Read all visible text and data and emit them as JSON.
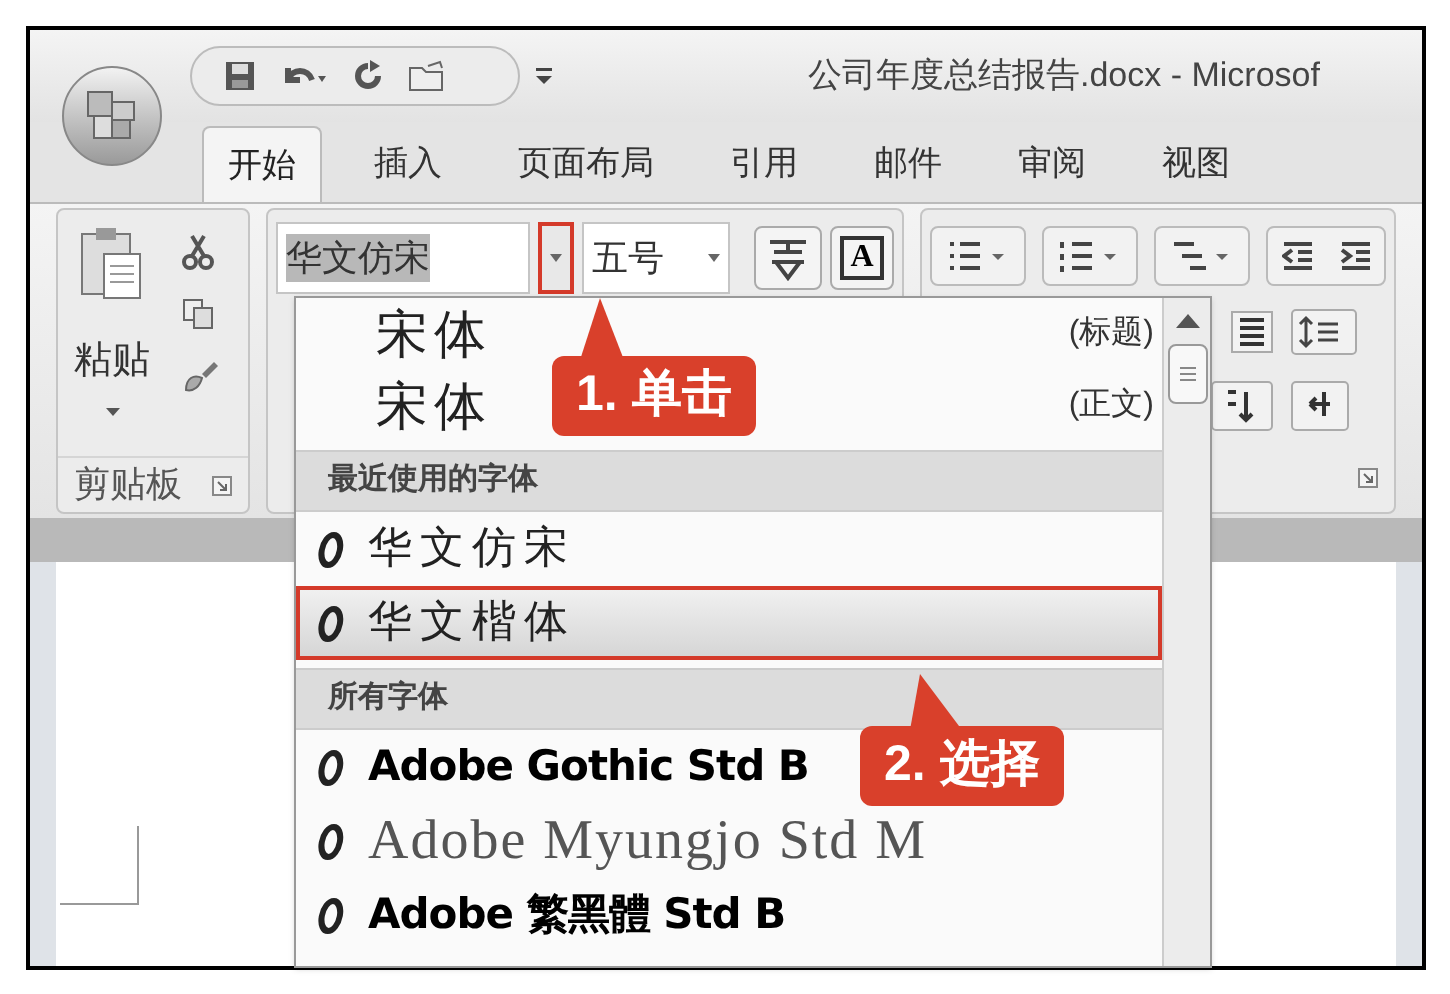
{
  "window": {
    "title": "公司年度总结报告.docx - Microsof"
  },
  "tabs": [
    {
      "label": "开始",
      "selected": true
    },
    {
      "label": "插入",
      "selected": false
    },
    {
      "label": "页面布局",
      "selected": false
    },
    {
      "label": "引用",
      "selected": false
    },
    {
      "label": "邮件",
      "selected": false
    },
    {
      "label": "审阅",
      "selected": false
    },
    {
      "label": "视图",
      "selected": false
    }
  ],
  "clipboard_group": {
    "paste_label": "粘贴",
    "group_label": "剪贴板"
  },
  "font_group": {
    "font_name": "华文仿宋",
    "font_size": "五号",
    "font_size_button_label": "A"
  },
  "font_dropdown": {
    "items": [
      {
        "kind": "theme",
        "name": "宋体",
        "tag": "(标题)"
      },
      {
        "kind": "theme",
        "name": "宋体",
        "tag": "(正文)"
      },
      {
        "kind": "header",
        "name": "最近使用的字体"
      },
      {
        "kind": "brush",
        "name": "华文仿宋",
        "selected": false
      },
      {
        "kind": "brush",
        "name": "华文楷体",
        "selected": true
      },
      {
        "kind": "header",
        "name": "所有字体"
      },
      {
        "kind": "bold",
        "name": "Adobe Gothic Std B",
        "selected": false
      },
      {
        "kind": "serif",
        "name": "Adobe Myungjo Std M",
        "selected": false
      },
      {
        "kind": "bold",
        "name": "Adobe 繁黑體 Std B",
        "selected": false
      }
    ]
  },
  "callouts": [
    {
      "text": "1. 单击"
    },
    {
      "text": "2. 选择"
    }
  ]
}
